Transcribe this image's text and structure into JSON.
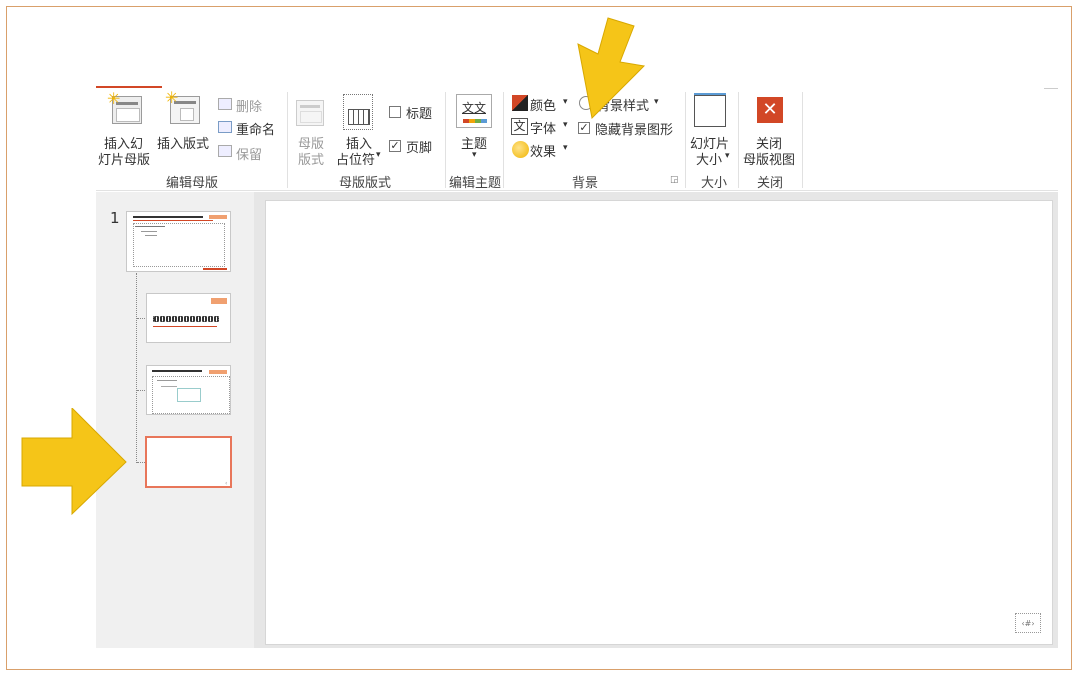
{
  "ribbon": {
    "group_edit_master": {
      "label": "编辑母版",
      "insert_master_l1": "插入幻",
      "insert_master_l2": "灯片母版",
      "insert_layout": "插入版式",
      "delete": "删除",
      "rename": "重命名",
      "preserve": "保留"
    },
    "group_master_layout": {
      "label": "母版版式",
      "master_layout_l1": "母版",
      "master_layout_l2": "版式",
      "insert_placeholder_l1": "插入",
      "insert_placeholder_l2": "占位符",
      "title_checkbox": "标题",
      "footer_checkbox": "页脚",
      "title_checked": false,
      "footer_checked": true
    },
    "group_edit_theme": {
      "label": "编辑主题",
      "theme": "主题",
      "theme_icon_text": "文文"
    },
    "group_background": {
      "label": "背景",
      "colors": "颜色",
      "fonts": "字体",
      "effects": "效果",
      "background_styles": "背景样式",
      "hide_background_graphics": "隐藏背景图形",
      "hide_checked": true,
      "fonts_icon_text": "文"
    },
    "group_size": {
      "label": "大小",
      "slide_size_l1": "幻灯片",
      "slide_size_l2": "大小"
    },
    "group_close": {
      "label": "关闭",
      "close_l1": "关闭",
      "close_l2": "母版视图"
    }
  },
  "slides_panel": {
    "slide_number": "1"
  },
  "colors": {
    "accent": "#d24726",
    "arrow": "#f5c518",
    "frame": "#d9a06b"
  }
}
